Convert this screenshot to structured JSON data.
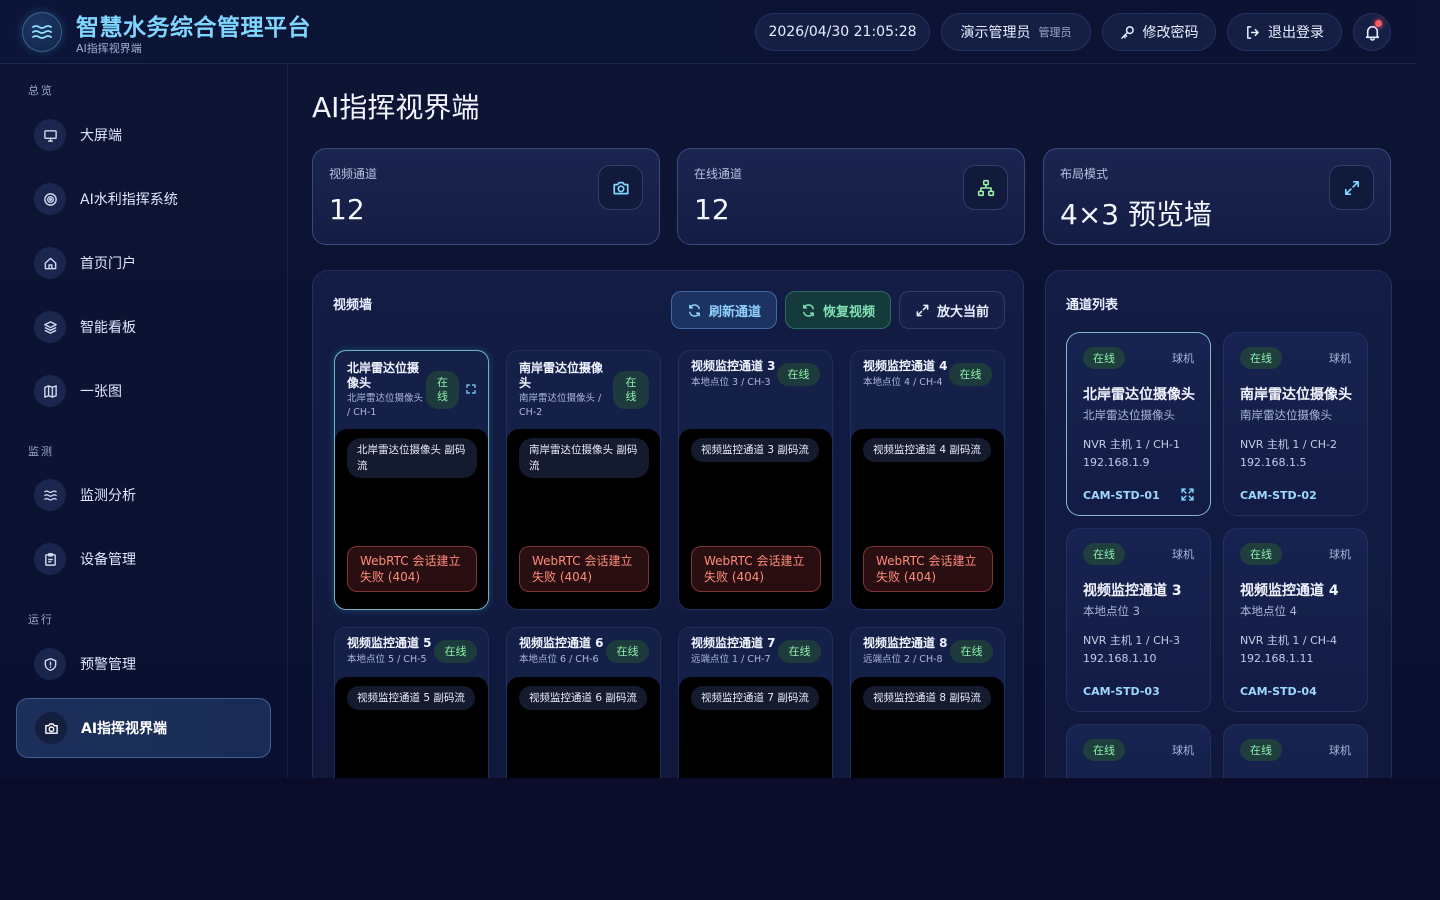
{
  "header": {
    "title": "智慧水务综合管理平台",
    "subtitle": "AI指挥视界端",
    "datetime": "2026/04/30 21:05:28",
    "user_name": "演示管理员",
    "user_role": "管理员",
    "change_password": "修改密码",
    "logout": "退出登录"
  },
  "sidebar": {
    "sections": [
      "总览",
      "监测",
      "运行"
    ],
    "items": [
      {
        "label": "大屏端",
        "icon": "monitor-icon"
      },
      {
        "label": "AI水利指挥系统",
        "icon": "target-icon"
      },
      {
        "label": "首页门户",
        "icon": "home-icon"
      },
      {
        "label": "智能看板",
        "icon": "layers-icon"
      },
      {
        "label": "一张图",
        "icon": "map-icon"
      },
      {
        "label": "监测分析",
        "icon": "wave-icon"
      },
      {
        "label": "设备管理",
        "icon": "clipboard-icon"
      },
      {
        "label": "预警管理",
        "icon": "shield-alert-icon"
      },
      {
        "label": "AI指挥视界端",
        "icon": "camera-icon",
        "active": true
      }
    ]
  },
  "page": {
    "title": "AI指挥视界端"
  },
  "stats": [
    {
      "label": "视频通道",
      "value": "12",
      "icon": "camera-icon"
    },
    {
      "label": "在线通道",
      "value": "12",
      "icon": "network-icon"
    },
    {
      "label": "布局模式",
      "value": "4×3 预览墙",
      "icon": "expand-icon"
    }
  ],
  "video_wall": {
    "title": "视频墙",
    "buttons": {
      "refresh": "刷新通道",
      "restore": "恢复视频",
      "zoom": "放大当前"
    },
    "tiles": [
      {
        "name": "北岸雷达位摄像头",
        "meta": "北岸雷达位摄像头 / CH-1",
        "status": "在线",
        "stream": "北岸雷达位摄像头 副码流",
        "error": "WebRTC 会话建立失败 (404)"
      },
      {
        "name": "南岸雷达位摄像头",
        "meta": "南岸雷达位摄像头 / CH-2",
        "status": "在线",
        "stream": "南岸雷达位摄像头 副码流",
        "error": "WebRTC 会话建立失败 (404)"
      },
      {
        "name": "视频监控通道 3",
        "meta": "本地点位 3 / CH-3",
        "status": "在线",
        "stream": "视频监控通道 3 副码流",
        "error": "WebRTC 会话建立失败 (404)"
      },
      {
        "name": "视频监控通道 4",
        "meta": "本地点位 4 / CH-4",
        "status": "在线",
        "stream": "视频监控通道 4 副码流",
        "error": "WebRTC 会话建立失败 (404)"
      },
      {
        "name": "视频监控通道 5",
        "meta": "本地点位 5 / CH-5",
        "status": "在线",
        "stream": "视频监控通道 5 副码流"
      },
      {
        "name": "视频监控通道 6",
        "meta": "本地点位 6 / CH-6",
        "status": "在线",
        "stream": "视频监控通道 6 副码流"
      },
      {
        "name": "视频监控通道 7",
        "meta": "远端点位 1 / CH-7",
        "status": "在线",
        "stream": "视频监控通道 7 副码流"
      },
      {
        "name": "视频监控通道 8",
        "meta": "远端点位 2 / CH-8",
        "status": "在线",
        "stream": "视频监控通道 8 副码流"
      }
    ]
  },
  "channel_list": {
    "title": "通道列表",
    "cards": [
      {
        "status": "在线",
        "type": "球机",
        "name": "北岸雷达位摄像头",
        "desc": "北岸雷达位摄像头",
        "nvr": "NVR 主机 1 / CH-1",
        "ip": "192.168.1.9",
        "code": "CAM-STD-01"
      },
      {
        "status": "在线",
        "type": "球机",
        "name": "南岸雷达位摄像头",
        "desc": "南岸雷达位摄像头",
        "nvr": "NVR 主机 1 / CH-2",
        "ip": "192.168.1.5",
        "code": "CAM-STD-02"
      },
      {
        "status": "在线",
        "type": "球机",
        "name": "视频监控通道 3",
        "desc": "本地点位 3",
        "nvr": "NVR 主机 1 / CH-3",
        "ip": "192.168.1.10",
        "code": "CAM-STD-03"
      },
      {
        "status": "在线",
        "type": "球机",
        "name": "视频监控通道 4",
        "desc": "本地点位 4",
        "nvr": "NVR 主机 1 / CH-4",
        "ip": "192.168.1.11",
        "code": "CAM-STD-04"
      },
      {
        "status": "在线",
        "type": "球机"
      },
      {
        "status": "在线",
        "type": "球机"
      }
    ]
  },
  "colors": {
    "accent": "#7fd6ff",
    "online": "#8cf0a8",
    "error": "#ff8a7a",
    "background": "#0b0c2a"
  }
}
